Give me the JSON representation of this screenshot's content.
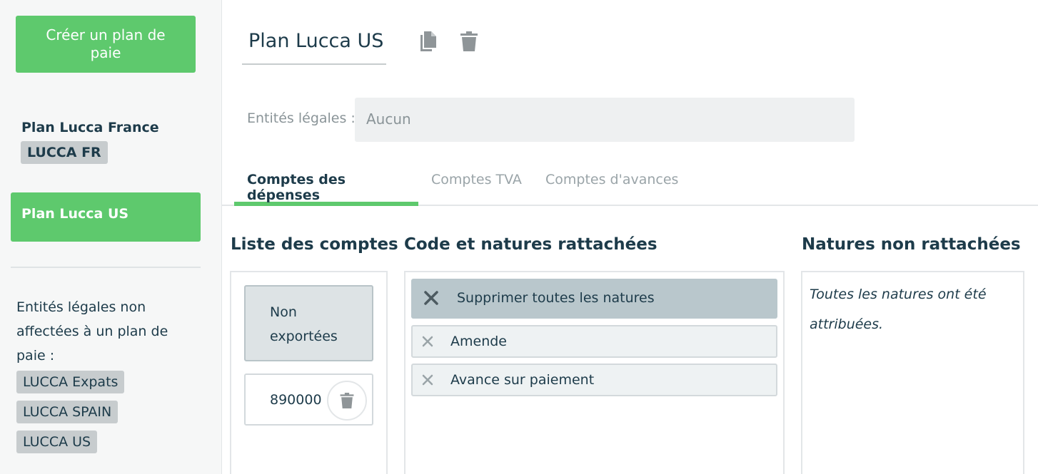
{
  "sidebar": {
    "create_label": "Créer un plan de paie",
    "plans": [
      {
        "name": "Plan Lucca France",
        "tag": "LUCCA FR"
      },
      {
        "name": "Plan Lucca US"
      }
    ],
    "unassigned_label": "Entités légales non affectées à un plan de paie :",
    "unassigned_tags": [
      "LUCCA Expats",
      "LUCCA SPAIN",
      "LUCCA US"
    ]
  },
  "header": {
    "title": "Plan Lucca US",
    "entities_label": "Entités légales :",
    "entities_value": "Aucun"
  },
  "tabs": [
    "Comptes des dépenses",
    "Comptes TVA",
    "Comptes d'avances"
  ],
  "columns": {
    "accounts_title": "Liste des comptes",
    "attached_title": "Code et natures rattachées",
    "unattached_title": "Natures non rattachées"
  },
  "accounts": {
    "non_exported": "Non exportées",
    "items": [
      "890000"
    ]
  },
  "attached": {
    "remove_all_label": "Supprimer toutes les natures",
    "natures": [
      "Amende",
      "Avance sur paiement"
    ]
  },
  "unattached": {
    "empty_message": "Toutes les natures ont été attribuées."
  },
  "colors": {
    "accent": "#5ec96d",
    "text": "#1d3b4a",
    "muted": "#9aa4a8"
  }
}
